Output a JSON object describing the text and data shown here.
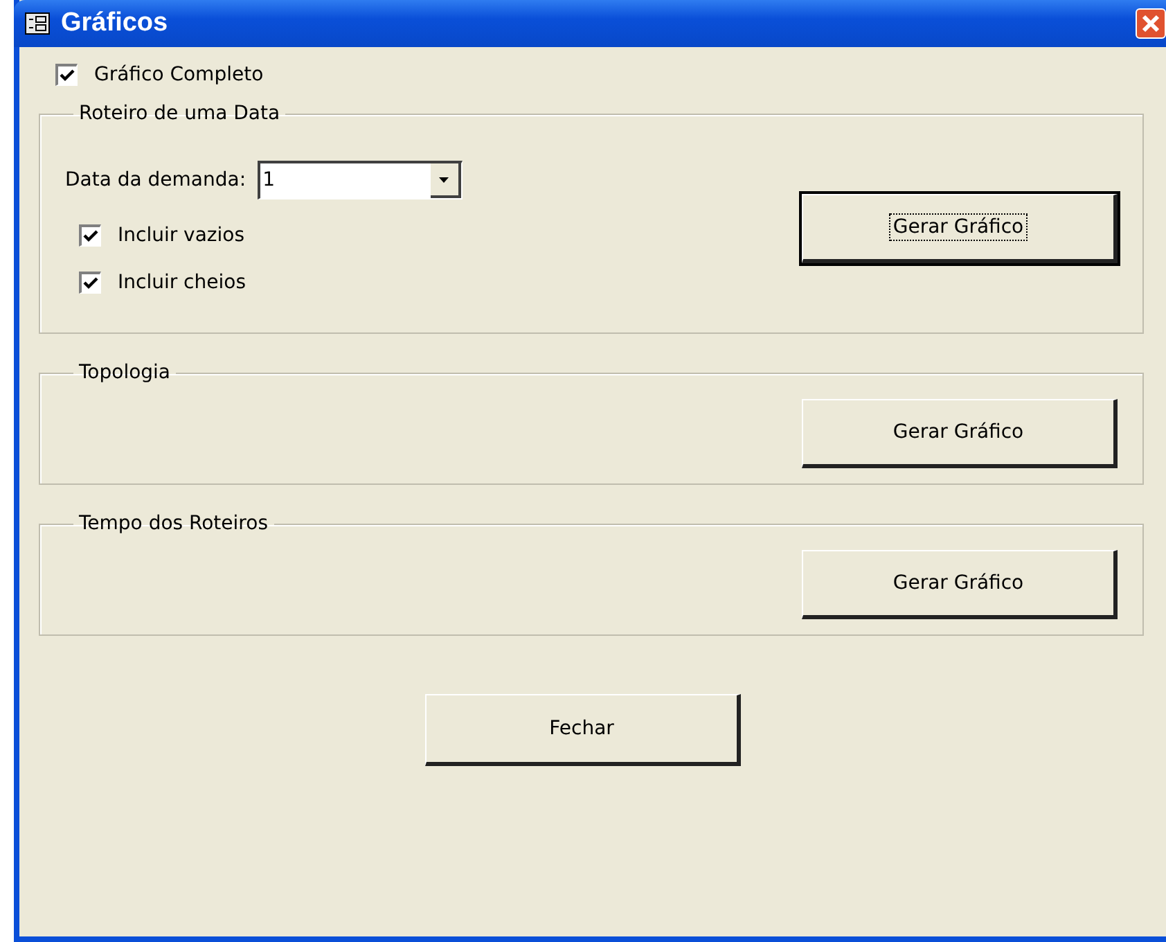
{
  "window": {
    "title": "Gráficos"
  },
  "complete_chart": {
    "label": "Gráfico Completo",
    "checked": true
  },
  "groups": [
    {
      "title": "Roteiro de uma Data",
      "date_field": {
        "label": "Data da demanda:",
        "value": "1"
      },
      "options": [
        {
          "label": "Incluir vazios",
          "checked": true
        },
        {
          "label": "Incluir cheios",
          "checked": true
        }
      ],
      "button": {
        "label": "Gerar Gráfico",
        "default": true
      }
    },
    {
      "title": "Topologia",
      "button": {
        "label": "Gerar Gráfico",
        "default": false
      }
    },
    {
      "title": "Tempo dos Roteiros",
      "button": {
        "label": "Gerar Gráfico",
        "default": false
      }
    }
  ],
  "close_button": {
    "label": "Fechar"
  }
}
